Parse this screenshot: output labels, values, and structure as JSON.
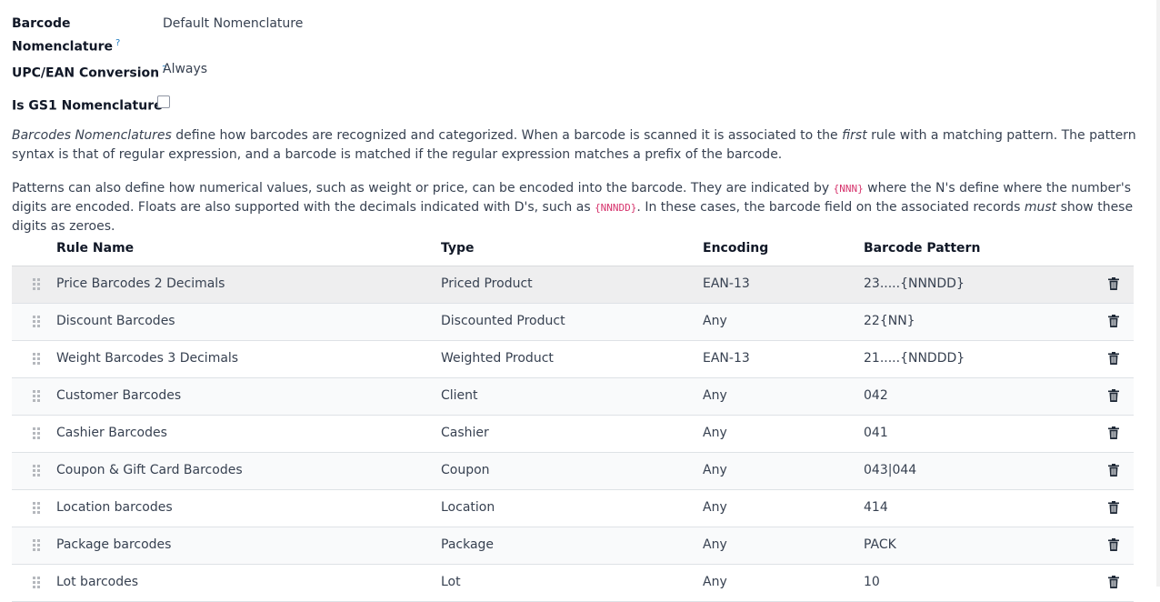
{
  "fields": {
    "barcode_nomenclature": {
      "label_line1": "Barcode",
      "label_line2": "Nomenclature",
      "help": "?",
      "value": "Default Nomenclature"
    },
    "upc_ean_conversion": {
      "label": "UPC/EAN Conversion",
      "help": "?",
      "value": "Always"
    },
    "is_gs1": {
      "label": "Is GS1 Nomenclature",
      "help": "?",
      "checked": false
    }
  },
  "description": {
    "p1": {
      "part1_em": "Barcodes Nomenclatures",
      "part2": " define how barcodes are recognized and categorized. When a barcode is scanned it is associated to the ",
      "part3_em": "first",
      "part4": " rule with a matching pattern. The pattern syntax is that of regular expression, and a barcode is matched if the regular expression matches a prefix of the barcode."
    },
    "p2": {
      "part1": "Patterns can also define how numerical values, such as weight or price, can be encoded into the barcode. They are indicated by ",
      "code1": "{NNN}",
      "part2": " where the N's define where the number's digits are encoded. Floats are also supported with the decimals indicated with D's, such as ",
      "code2": "{NNNDD}",
      "part3": ". In these cases, the barcode field on the associated records ",
      "part4_em": "must",
      "part5": " show these digits as zeroes."
    }
  },
  "table": {
    "headers": {
      "rule_name": "Rule Name",
      "type": "Type",
      "encoding": "Encoding",
      "pattern": "Barcode Pattern"
    },
    "rows": [
      {
        "name": "Price Barcodes 2 Decimals",
        "type": "Priced Product",
        "encoding": "EAN-13",
        "pattern": "23.....{NNNDD}"
      },
      {
        "name": "Discount Barcodes",
        "type": "Discounted Product",
        "encoding": "Any",
        "pattern": "22{NN}"
      },
      {
        "name": "Weight Barcodes 3 Decimals",
        "type": "Weighted Product",
        "encoding": "EAN-13",
        "pattern": "21.....{NNDDD}"
      },
      {
        "name": "Customer Barcodes",
        "type": "Client",
        "encoding": "Any",
        "pattern": "042"
      },
      {
        "name": "Cashier Barcodes",
        "type": "Cashier",
        "encoding": "Any",
        "pattern": "041"
      },
      {
        "name": "Coupon & Gift Card Barcodes",
        "type": "Coupon",
        "encoding": "Any",
        "pattern": "043|044"
      },
      {
        "name": "Location barcodes",
        "type": "Location",
        "encoding": "Any",
        "pattern": "414"
      },
      {
        "name": "Package barcodes",
        "type": "Package",
        "encoding": "Any",
        "pattern": "PACK"
      },
      {
        "name": "Lot barcodes",
        "type": "Lot",
        "encoding": "Any",
        "pattern": "10"
      }
    ],
    "row_icons": {
      "handle": "drag-handle-icon",
      "delete": "trash-icon"
    }
  },
  "colors": {
    "help": "#1f7bc1",
    "code": "#d6336c",
    "text": "#374151",
    "heading": "#111827",
    "hover_row": "#eeeeef"
  }
}
